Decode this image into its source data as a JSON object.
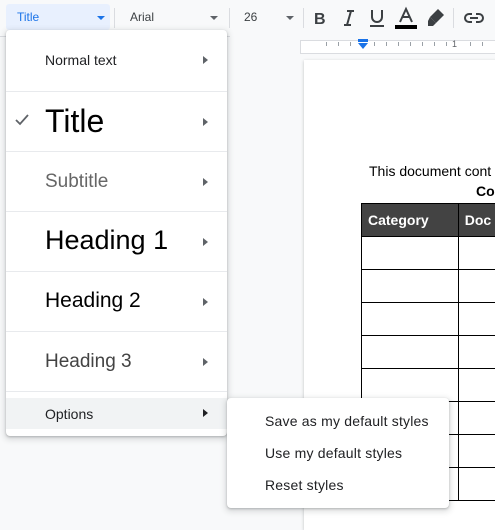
{
  "toolbar": {
    "style_value": "Title",
    "font_value": "Arial",
    "size_value": "26",
    "icons": [
      "chevron-down-icon",
      "bold-icon",
      "italic-icon",
      "underline-icon",
      "text-color-icon",
      "highlight-icon",
      "link-icon"
    ],
    "text_color_bar": "#000000"
  },
  "ruler": {
    "number": "1"
  },
  "document": {
    "intro_text": "This document cont",
    "bold_text": "Co",
    "table": {
      "headers": [
        "Category",
        "Doc"
      ],
      "header_bg": "#434343",
      "empty_rows": 8
    }
  },
  "styles_menu": {
    "items": [
      {
        "label": "Normal text",
        "checked": false
      },
      {
        "label": "Title",
        "checked": true
      },
      {
        "label": "Subtitle",
        "checked": false
      },
      {
        "label": "Heading 1",
        "checked": false
      },
      {
        "label": "Heading 2",
        "checked": false
      },
      {
        "label": "Heading 3",
        "checked": false
      }
    ],
    "options_label": "Options"
  },
  "options_submenu": {
    "items": [
      {
        "label": "Save as my default styles"
      },
      {
        "label": "Use my default styles"
      },
      {
        "label": "Reset styles"
      }
    ]
  },
  "colors": {
    "accent": "#1a73e8",
    "selected_bg": "#e8f0fe",
    "hover_bg": "#f1f3f4"
  }
}
